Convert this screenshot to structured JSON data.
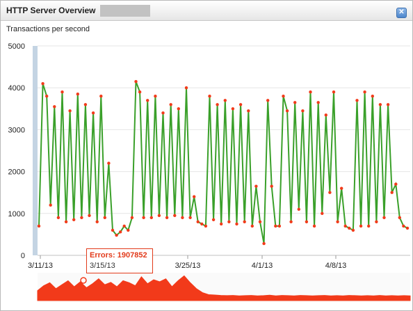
{
  "window": {
    "title": "HTTP Server Overview",
    "subtitle": "Transactions per second",
    "close_icon": "close-icon"
  },
  "colors": {
    "line": "#3aa02a",
    "point": "#f23a1a",
    "error": "#f23a1a",
    "range": "#c4d4e3",
    "grid": "#e6e6e6"
  },
  "tooltip": {
    "label": "Errors: 1907852",
    "date": "3/15/13"
  },
  "chart_data": [
    {
      "type": "line",
      "title": "Transactions per second",
      "x_ticks": [
        "3/11/13",
        "3/15/13",
        "3/25/13",
        "4/1/13",
        "4/8/13"
      ],
      "y_ticks": [
        "0",
        "1000",
        "2000",
        "3000",
        "4000",
        "5000"
      ],
      "ylim": [
        0,
        5000
      ],
      "grid": true,
      "series": [
        {
          "values": [
            700,
            4100,
            3800,
            1200,
            3550,
            900,
            3900,
            800,
            3450,
            850,
            3850,
            900,
            3600,
            950,
            3400,
            800,
            3800,
            900,
            2200,
            600,
            480,
            560,
            700,
            600,
            900,
            4150,
            3900,
            900,
            3700,
            900,
            3800,
            950,
            3400,
            900,
            3600,
            950,
            3500,
            900,
            4000,
            900,
            1400,
            800,
            750,
            700,
            3800,
            850,
            3600,
            750,
            3700,
            800,
            3500,
            750,
            3600,
            800,
            3450,
            700,
            1650,
            800,
            280,
            3700,
            1650,
            700,
            700,
            3800,
            3450,
            800,
            3650,
            1100,
            3450,
            800,
            3900,
            700,
            3650,
            1000,
            3350,
            1500,
            3900,
            800,
            1600,
            700,
            650,
            600,
            3700,
            700,
            3900,
            700,
            3800,
            800,
            3600,
            900,
            3600,
            1500,
            1700,
            900,
            700,
            650
          ]
        }
      ]
    },
    {
      "type": "area",
      "title": "",
      "series": [
        {
          "values": [
            50,
            75,
            90,
            60,
            80,
            100,
            70,
            95,
            65,
            85,
            110,
            80,
            92,
            70,
            100,
            90,
            75,
            120,
            85,
            105,
            95,
            110,
            70,
            100,
            125,
            90,
            60,
            40,
            30,
            28,
            26,
            25,
            26,
            24,
            25,
            26,
            24,
            25,
            27,
            24,
            26,
            25,
            24,
            26,
            25,
            24,
            25,
            26,
            24,
            25,
            24,
            26,
            25,
            24,
            25,
            24,
            26,
            24,
            25,
            24,
            25,
            24
          ]
        }
      ]
    }
  ]
}
